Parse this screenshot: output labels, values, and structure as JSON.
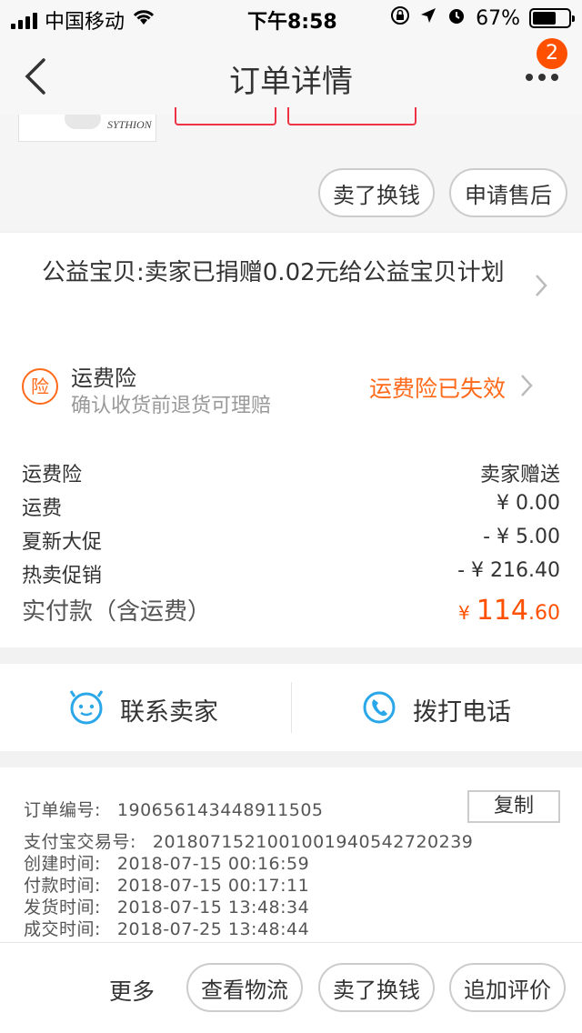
{
  "status_bar": {
    "carrier": "中国移动",
    "time": "下午8:58",
    "battery": "67%",
    "battery_level": 0.67
  },
  "nav": {
    "title": "订单详情",
    "badge_count": "2"
  },
  "product": {
    "thumb_text": "SYTHION"
  },
  "actions_top": {
    "sell_exchange": "卖了换钱",
    "after_sale": "申请售后"
  },
  "charity": {
    "text": "公益宝贝:卖家已捐赠0.02元给公益宝贝计划"
  },
  "insurance": {
    "icon_char": "险",
    "title": "运费险",
    "subtitle": "确认收货前退货可理赔",
    "status": "运费险已失效"
  },
  "fees": [
    {
      "label": "运费险",
      "value": "卖家赠送"
    },
    {
      "label": "运费",
      "value": "¥ 0.00"
    },
    {
      "label": "夏新大促",
      "value": "- ¥ 5.00"
    },
    {
      "label": "热卖促销",
      "value": "- ¥ 216.40"
    }
  ],
  "total": {
    "label": "实付款（含运费）",
    "currency": "¥",
    "integer": "114",
    "decimal": ".60"
  },
  "contact": {
    "seller": "联系卖家",
    "phone": "拨打电话"
  },
  "order_info": {
    "order_no_label": "订单编号:",
    "order_no": "1906561434489​11505",
    "copy": "复制",
    "alipay_label": "支付宝交易号:",
    "alipay_no": "2018071521001001940542720239",
    "created_label": "创建时间:",
    "created": "2018-07-15 00:16:59",
    "paid_label": "付款时间:",
    "paid": "2018-07-15 00:17:11",
    "shipped_label": "发货时间:",
    "shipped": "2018-07-15 13:48:34",
    "done_label": "成交时间:",
    "done": "2018-07-25 13:48:44"
  },
  "bottom_bar": {
    "more": "更多",
    "logistics": "查看物流",
    "sell_exchange": "卖了换钱",
    "add_review": "追加评价"
  },
  "colors": {
    "accent": "#ff6a1a",
    "badge": "#ff5000",
    "blue": "#2aa7e8"
  }
}
